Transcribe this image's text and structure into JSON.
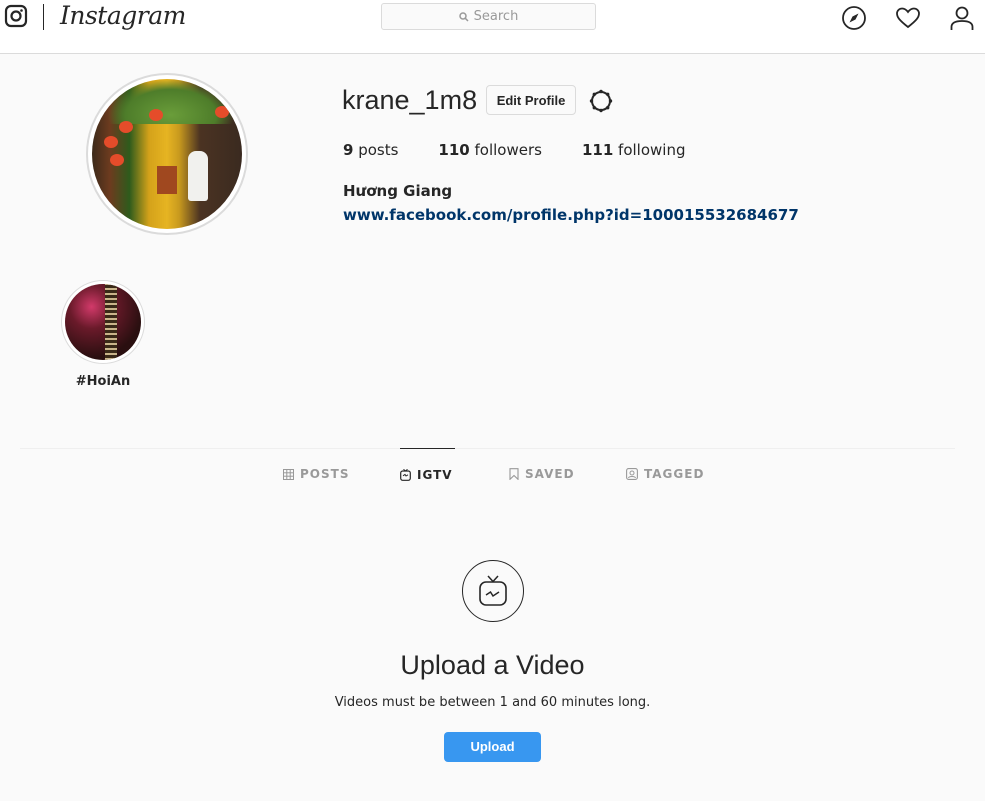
{
  "header": {
    "brand": "Instagram",
    "search_placeholder": "Search",
    "nav_icons": [
      "compass-icon",
      "heart-icon",
      "user-icon"
    ]
  },
  "profile": {
    "username": "krane_1m8",
    "edit_label": "Edit Profile",
    "stats": {
      "posts_count": "9",
      "posts_label": " posts",
      "followers_count": "110",
      "followers_label": " followers",
      "following_count": "111",
      "following_label": " following"
    },
    "full_name": "Hương Giang",
    "website": "www.facebook.com/profile.php?id=100015532684677"
  },
  "highlights": [
    {
      "label": "#HoiAn"
    }
  ],
  "tabs": [
    {
      "label": "POSTS",
      "icon": "grid-icon",
      "active": false
    },
    {
      "label": "IGTV",
      "icon": "igtv-icon",
      "active": true
    },
    {
      "label": "SAVED",
      "icon": "bookmark-icon",
      "active": false
    },
    {
      "label": "TAGGED",
      "icon": "tagged-icon",
      "active": false
    }
  ],
  "empty_state": {
    "title": "Upload a Video",
    "subtitle": "Videos must be between 1 and 60 minutes long.",
    "button_label": "Upload"
  },
  "colors": {
    "accent": "#3897f0",
    "link": "#003569",
    "text": "#262626",
    "muted": "#999999",
    "background": "#fafafa"
  }
}
